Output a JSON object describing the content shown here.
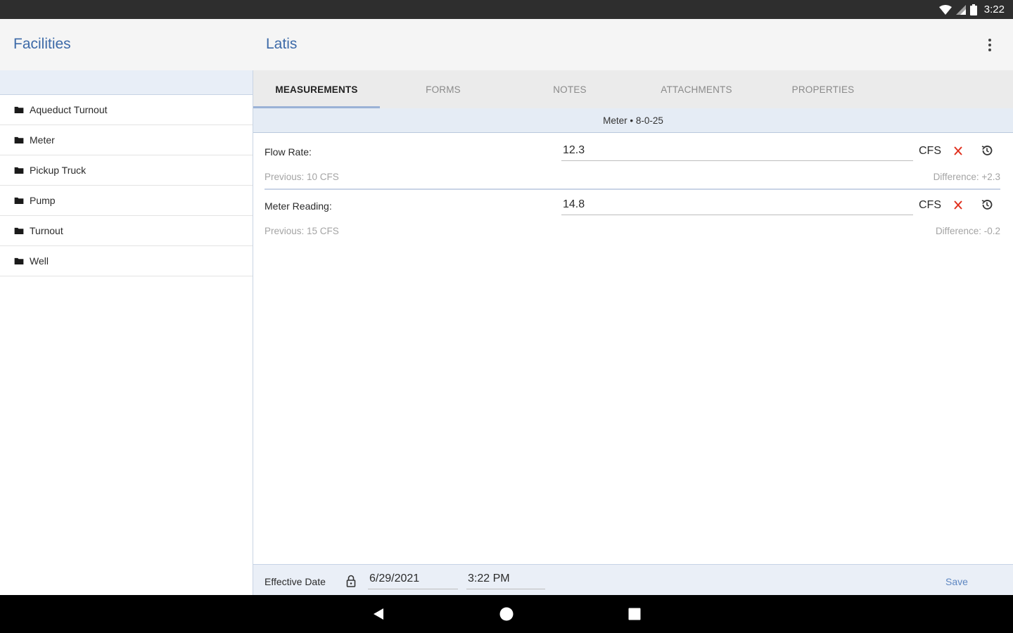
{
  "status_bar": {
    "time": "3:22"
  },
  "app_bar": {
    "left_title": "Facilities",
    "right_title": "Latis"
  },
  "facilities": [
    {
      "label": "Aqueduct Turnout",
      "icon": "folder-icon"
    },
    {
      "label": "Meter",
      "icon": "folder-icon"
    },
    {
      "label": "Pickup Truck",
      "icon": "folder-icon"
    },
    {
      "label": "Pump",
      "icon": "folder-icon"
    },
    {
      "label": "Turnout",
      "icon": "folder-icon"
    },
    {
      "label": "Well",
      "icon": "folder-icon"
    }
  ],
  "tabs": [
    {
      "label": "MEASUREMENTS",
      "active": true
    },
    {
      "label": "FORMS",
      "active": false
    },
    {
      "label": "NOTES",
      "active": false
    },
    {
      "label": "ATTACHMENTS",
      "active": false
    },
    {
      "label": "PROPERTIES",
      "active": false
    }
  ],
  "meter_header": "Meter • 8-0-25",
  "measurements": [
    {
      "label": "Flow Rate:",
      "value": "12.3",
      "unit": "CFS",
      "previous": "Previous: 10 CFS",
      "difference": "Difference: +2.3"
    },
    {
      "label": "Meter Reading:",
      "value": "14.8",
      "unit": "CFS",
      "previous": "Previous: 15 CFS",
      "difference": "Difference: -0.2"
    }
  ],
  "footer": {
    "effective_label": "Effective Date",
    "date": "6/29/2021",
    "time": "3:22 PM",
    "save_label": "Save"
  },
  "colors": {
    "accent": "#3d6aa8",
    "clear": "#e0301e",
    "link": "#5e87c2"
  }
}
